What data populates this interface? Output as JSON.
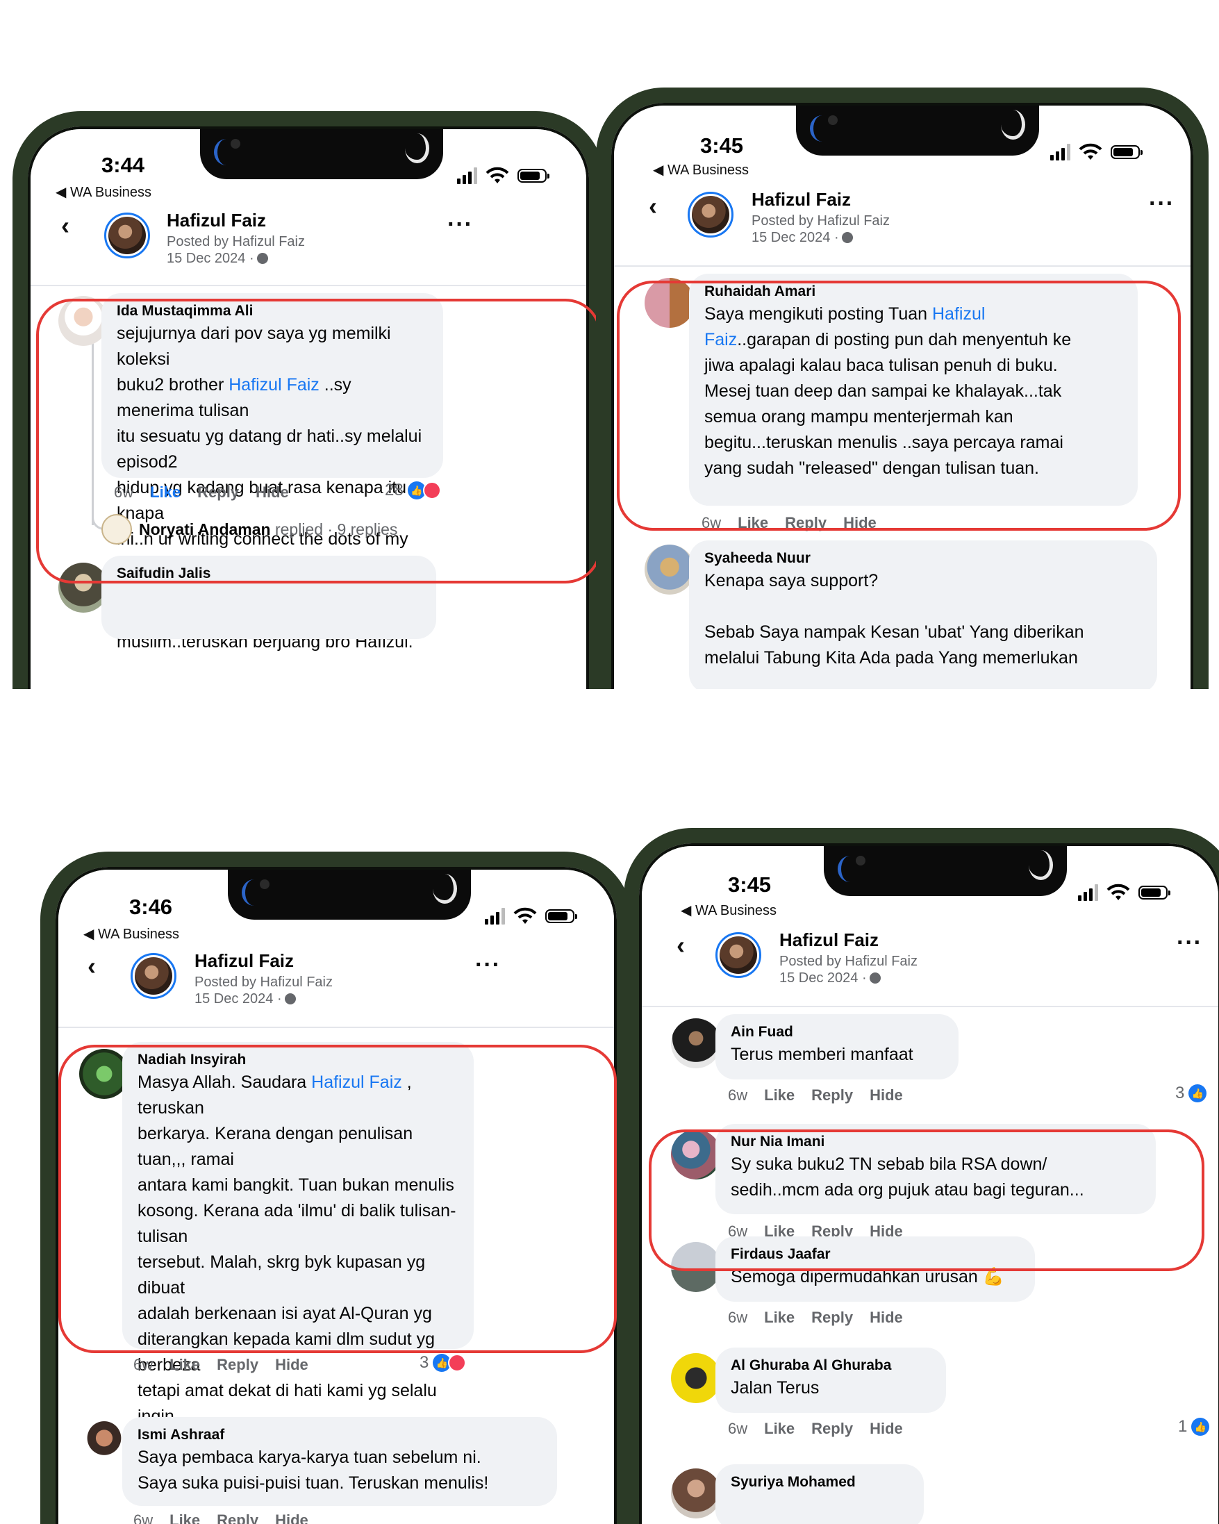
{
  "phones": [
    {
      "status": {
        "time": "3:44",
        "back_app": "◀ WA Business"
      },
      "post": {
        "author": "Hafizul Faiz",
        "posted_by": "Posted by Hafizul Faiz",
        "date": "15 Dec 2024 ·"
      },
      "comments": [
        {
          "name": "Ida Mustaqimma Ali",
          "text_before": "sejujurnya dari pov saya yg memilki koleksi\nbuku2 brother ",
          "link": "Hafizul Faiz",
          "text_after": " ..sy menerima tulisan\nitu sesuatu yg datang dr hati..sy melalui episod2\nhidup yg kadang buat rasa kenapa itu knapa\nini..n ur writing connect the dots of my feeling .n\nit leads me to find inner peace in\nspiritual .progress menjadi better\nmuslim..teruskan berjuang bro Hafizul.",
          "time": "6w",
          "like": "Like",
          "reply": "Reply",
          "hide": "Hide",
          "reactions": "28"
        },
        {
          "name": "Saifudin Jalis"
        }
      ],
      "replied": {
        "name": "Noryati Andaman",
        "label": "replied · 9 replies"
      }
    },
    {
      "status": {
        "time": "3:45",
        "back_app": "◀ WA Business"
      },
      "post": {
        "author": "Hafizul Faiz",
        "posted_by": "Posted by Hafizul Faiz",
        "date": "15 Dec 2024 ·"
      },
      "comments": [
        {
          "name": "Ruhaidah Amari",
          "text_before": "Saya mengikuti posting Tuan ",
          "link": "Hafizul\nFaiz",
          "text_after": "..garapan di posting pun dah menyentuh ke\njiwa apalagi kalau baca tulisan penuh di buku.\nMesej tuan deep dan sampai ke khalayak...tak\nsemua orang mampu menterjermah kan\nbegitu...teruskan menulis ..saya percaya ramai\nyang sudah \"released\" dengan tulisan tuan.",
          "time": "6w",
          "like": "Like",
          "reply": "Reply",
          "hide": "Hide"
        },
        {
          "name": "Syaheeda Nuur",
          "text": "Kenapa saya support?\n\nSebab Saya nampak Kesan 'ubat' Yang diberikan\nmelalui Tabung Kita Ada pada Yang memerlukan"
        }
      ]
    },
    {
      "status": {
        "time": "3:46",
        "back_app": "◀ WA Business"
      },
      "post": {
        "author": "Hafizul Faiz",
        "posted_by": "Posted by Hafizul Faiz",
        "date": "15 Dec 2024 ·"
      },
      "comments": [
        {
          "name": "Nadiah Insyirah",
          "text_before": "Masya Allah. Saudara ",
          "link": "Hafizul Faiz",
          "text_after": " , teruskan\nberkarya. Kerana dengan penulisan tuan,,, ramai\nantara kami bangkit. Tuan bukan menulis\nkosong. Kerana ada 'ilmu' di balik tulisan-tulisan\ntersebut. Malah, skrg byk kupasan yg dibuat\nadalah berkenaan isi ayat Al-Quran yg\nditerangkan kepada kami dlm sudut yg berbeza\ntetapi amat dekat di hati kami yg selalu ingin\nsembuh dari pelbagai luka. Terima kasih saudara\n@Hafizul Faiz.",
          "time": "6w",
          "like": "Like",
          "reply": "Reply",
          "hide": "Hide",
          "reactions": "3"
        },
        {
          "name": "Ismi Ashraaf",
          "text": "Saya pembaca karya-karya tuan sebelum ni.\nSaya suka puisi-puisi tuan. Teruskan menulis!",
          "time": "6w",
          "like": "Like",
          "reply": "Reply",
          "hide": "Hide"
        }
      ]
    },
    {
      "status": {
        "time": "3:45",
        "back_app": "◀ WA Business"
      },
      "post": {
        "author": "Hafizul Faiz",
        "posted_by": "Posted by Hafizul Faiz",
        "date": "15 Dec 2024 ·"
      },
      "comments": [
        {
          "name": "Ain Fuad",
          "text": "Terus memberi manfaat",
          "time": "6w",
          "like": "Like",
          "reply": "Reply",
          "hide": "Hide",
          "reactions": "3"
        },
        {
          "name": "Nur Nia Imani",
          "text": "Sy suka buku2 TN sebab bila RSA down/\nsedih..mcm ada org pujuk atau bagi teguran...",
          "time": "6w",
          "like": "Like",
          "reply": "Reply",
          "hide": "Hide"
        },
        {
          "name": "Firdaus Jaafar",
          "text": "Semoga dipermudahkan urusan 💪",
          "time": "6w",
          "like": "Like",
          "reply": "Reply",
          "hide": "Hide"
        },
        {
          "name": "Al Ghuraba Al Ghuraba",
          "text": "Jalan Terus",
          "time": "6w",
          "like": "Like",
          "reply": "Reply",
          "hide": "Hide",
          "reactions": "1"
        },
        {
          "name": "Syuriya Mohamed"
        }
      ]
    }
  ],
  "colors": {
    "accent": "#1877f2",
    "highlight": "#e53935",
    "frame": "#2b3a26",
    "bubble": "#f0f2f5"
  }
}
